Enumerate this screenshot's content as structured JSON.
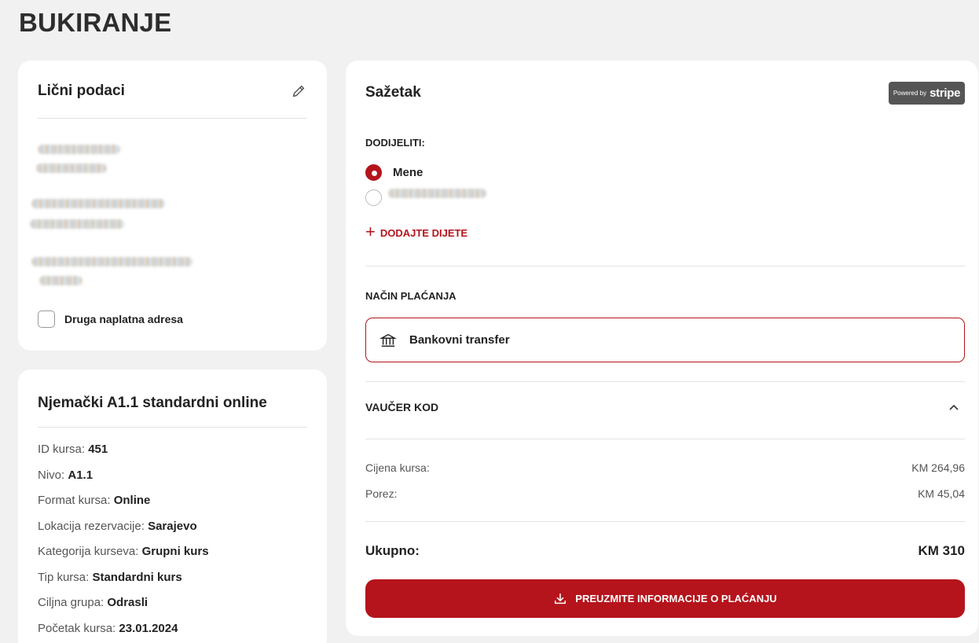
{
  "page": {
    "title": "BUKIRANJE"
  },
  "personal": {
    "title": "Lični podaci",
    "edit_icon": "pencil-icon",
    "checkbox_label": "Druga naplatna adresa",
    "checkbox_checked": false
  },
  "course": {
    "title": "Njemački A1.1 standardni online",
    "details": [
      {
        "label": "ID kursa:",
        "value": "451"
      },
      {
        "label": "Nivo:",
        "value": "A1.1"
      },
      {
        "label": "Format kursa:",
        "value": "Online"
      },
      {
        "label": "Lokacija rezervacije:",
        "value": "Sarajevo"
      },
      {
        "label": "Kategorija kurseva:",
        "value": "Grupni kurs"
      },
      {
        "label": "Tip kursa:",
        "value": "Standardni kurs"
      },
      {
        "label": "Ciljna grupa:",
        "value": "Odrasli"
      },
      {
        "label": "Početak kursa:",
        "value": "23.01.2024"
      }
    ]
  },
  "summary": {
    "title": "Sažetak",
    "stripe_badge": {
      "powered_by": "Powered by",
      "brand": "stripe"
    },
    "assign_label": "DODIJELITI:",
    "assign_options": [
      {
        "label": "Mene",
        "selected": true
      }
    ],
    "add_child_label": "DODAJTE DIJETE",
    "payment_method_label": "NAČIN PLAĆANJA",
    "payment_method_option": "Bankovni transfer",
    "voucher_label": "VAUČER KOD",
    "prices": [
      {
        "label": "Cijena kursa:",
        "value": "KM 264,96"
      },
      {
        "label": "Porez:",
        "value": "KM 45,04"
      }
    ],
    "total_label": "Ukupno:",
    "total_value": "KM 310",
    "download_button": "PREUZMITE INFORMACIJE O PLAĆANJU"
  },
  "colors": {
    "accent": "#b5141c",
    "background": "#f1f1f1",
    "card": "#ffffff"
  }
}
